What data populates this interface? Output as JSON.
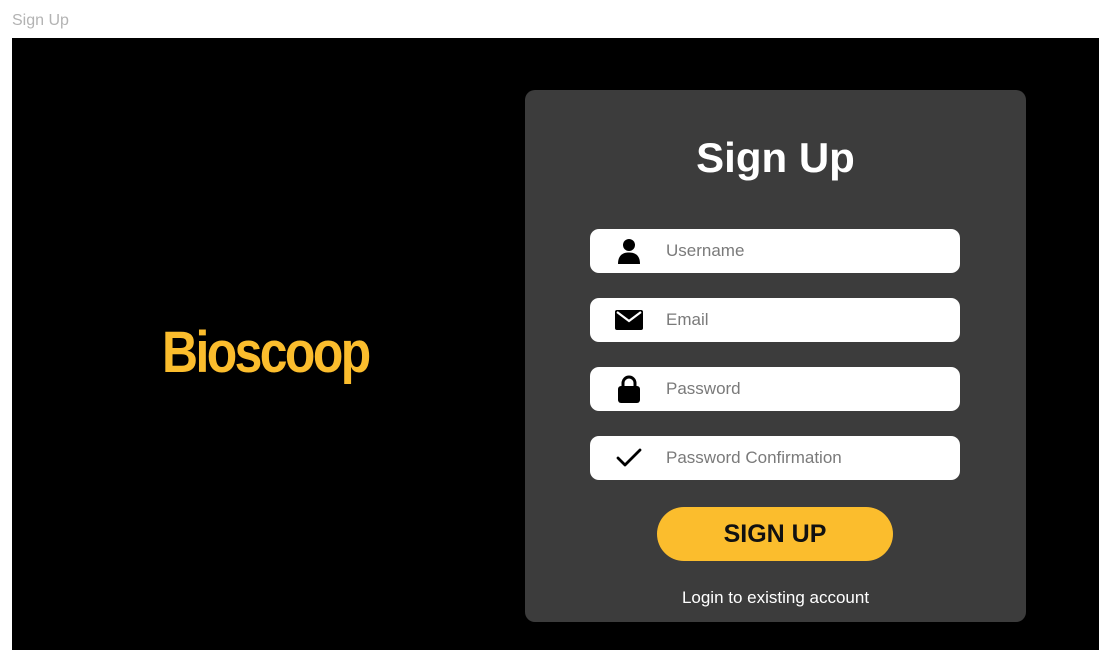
{
  "frame": {
    "label": "Sign Up"
  },
  "brand": {
    "name": "Bioscoop",
    "color": "#fbbd2d"
  },
  "form": {
    "title": "Sign Up",
    "fields": [
      {
        "name": "username",
        "placeholder": "Username",
        "value": "",
        "icon": "user-icon"
      },
      {
        "name": "email",
        "placeholder": "Email",
        "value": "",
        "icon": "envelope-icon"
      },
      {
        "name": "password",
        "placeholder": "Password",
        "value": "",
        "icon": "lock-icon"
      },
      {
        "name": "password_confirmation",
        "placeholder": "Password Confirmation",
        "value": "",
        "icon": "check-icon"
      }
    ],
    "submit_label": "SIGN UP",
    "submit_color": "#fbbd2d",
    "login_link": "Login to existing account"
  }
}
